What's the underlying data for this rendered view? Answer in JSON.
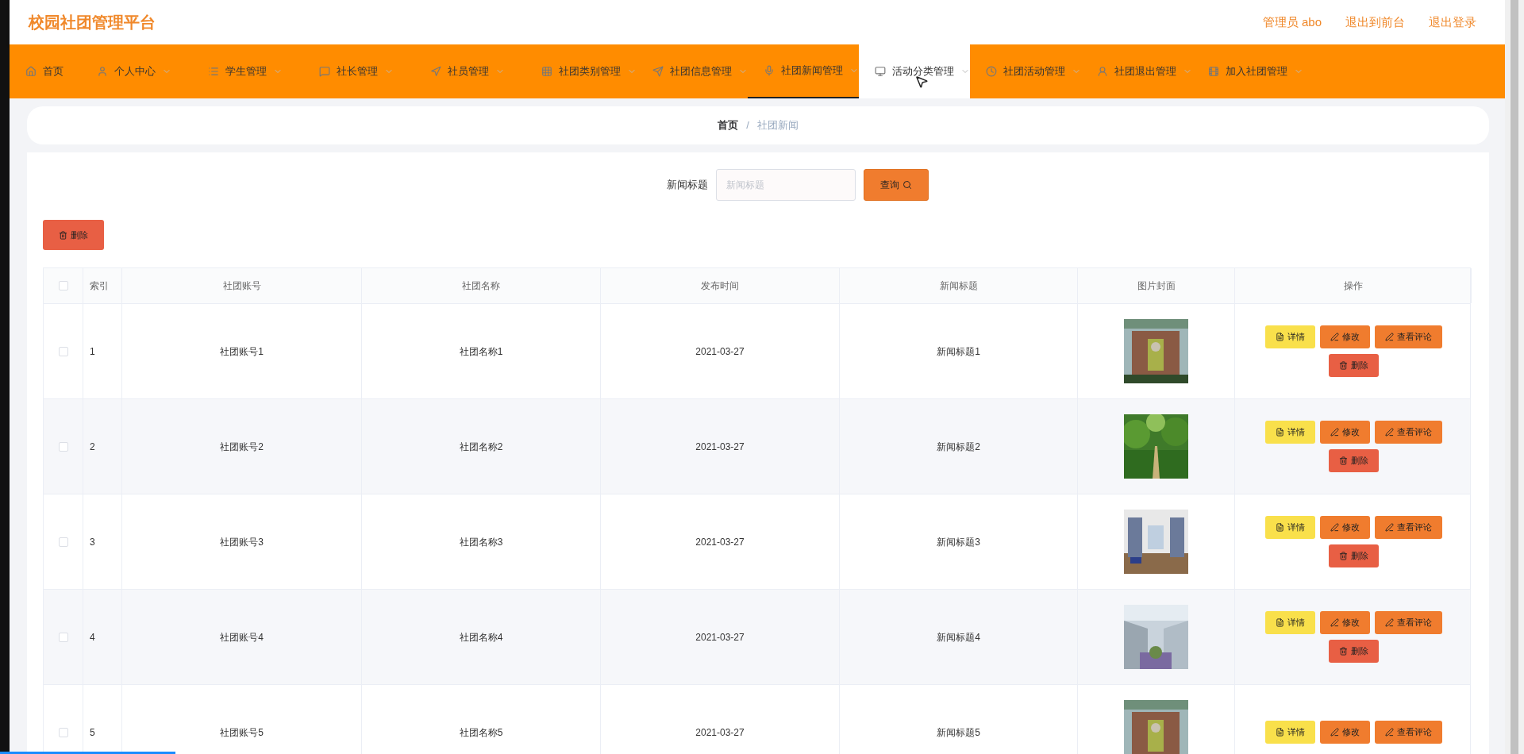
{
  "header": {
    "title": "校园社团管理平台",
    "links": [
      "管理员 abo",
      "退出到前台",
      "退出登录"
    ]
  },
  "nav": [
    {
      "label": "首页",
      "selected": false,
      "hovered": false,
      "dropdown": false
    },
    {
      "label": "个人中心",
      "selected": false,
      "hovered": false,
      "dropdown": true
    },
    {
      "label": "学生管理",
      "selected": false,
      "hovered": false,
      "dropdown": true
    },
    {
      "label": "社长管理",
      "selected": false,
      "hovered": false,
      "dropdown": true
    },
    {
      "label": "社员管理",
      "selected": false,
      "hovered": false,
      "dropdown": true
    },
    {
      "label": "社团类别管理",
      "selected": false,
      "hovered": false,
      "dropdown": true
    },
    {
      "label": "社团信息管理",
      "selected": false,
      "hovered": false,
      "dropdown": true
    },
    {
      "label": "社团新闻管理",
      "selected": true,
      "hovered": false,
      "dropdown": true
    },
    {
      "label": "活动分类管理",
      "selected": false,
      "hovered": true,
      "dropdown": true
    },
    {
      "label": "社团活动管理",
      "selected": false,
      "hovered": false,
      "dropdown": true
    },
    {
      "label": "社团退出管理",
      "selected": false,
      "hovered": false,
      "dropdown": true
    },
    {
      "label": "加入社团管理",
      "selected": false,
      "hovered": false,
      "dropdown": true
    }
  ],
  "breadcrumb": [
    "首页",
    "/",
    "社团新闻"
  ],
  "search": {
    "label": "新闻标题",
    "placeholder": "新闻标题",
    "button": "查询"
  },
  "bulk_delete": "删除",
  "table": {
    "select_all": {
      "checked": false
    },
    "columns": [
      "索引",
      "社团账号",
      "社团名称",
      "发布时间",
      "新闻标题",
      "图片封面",
      "操作"
    ],
    "rows": [
      {
        "checked": false,
        "cells": [
          "1",
          "社团账号1",
          "社团名称1",
          "2021-03-27",
          "新闻标题1"
        ],
        "cover": {
          "kind": "picture"
        },
        "actions": [
          {
            "label": "详情",
            "kind": "detail"
          },
          {
            "label": "修改",
            "kind": "edit"
          },
          {
            "label": "查看评论",
            "kind": "edit"
          },
          {
            "label": "删除",
            "kind": "delete"
          }
        ]
      },
      {
        "checked": false,
        "cells": [
          "2",
          "社团账号2",
          "社团名称2",
          "2021-03-27",
          "新闻标题2"
        ],
        "cover": {
          "kind": "picture"
        },
        "actions": [
          {
            "label": "详情",
            "kind": "detail"
          },
          {
            "label": "修改",
            "kind": "edit"
          },
          {
            "label": "查看评论",
            "kind": "edit"
          },
          {
            "label": "删除",
            "kind": "delete"
          }
        ]
      },
      {
        "checked": false,
        "cells": [
          "3",
          "社团账号3",
          "社团名称3",
          "2021-03-27",
          "新闻标题3"
        ],
        "cover": {
          "kind": "picture"
        },
        "actions": [
          {
            "label": "详情",
            "kind": "detail"
          },
          {
            "label": "修改",
            "kind": "edit"
          },
          {
            "label": "查看评论",
            "kind": "edit"
          },
          {
            "label": "删除",
            "kind": "delete"
          }
        ]
      },
      {
        "checked": false,
        "cells": [
          "4",
          "社团账号4",
          "社团名称4",
          "2021-03-27",
          "新闻标题4"
        ],
        "cover": {
          "kind": "picture"
        },
        "actions": [
          {
            "label": "详情",
            "kind": "detail"
          },
          {
            "label": "修改",
            "kind": "edit"
          },
          {
            "label": "查看评论",
            "kind": "edit"
          },
          {
            "label": "删除",
            "kind": "delete"
          }
        ]
      },
      {
        "checked": false,
        "cells": [
          "5",
          "社团账号5",
          "社团名称5",
          "2021-03-27",
          "新闻标题5"
        ],
        "cover": {
          "kind": "picture"
        },
        "actions": [
          {
            "label": "详情",
            "kind": "detail"
          },
          {
            "label": "修改",
            "kind": "edit"
          },
          {
            "label": "查看评论",
            "kind": "edit"
          }
        ]
      }
    ]
  },
  "playback": {
    "level": 0.115
  }
}
